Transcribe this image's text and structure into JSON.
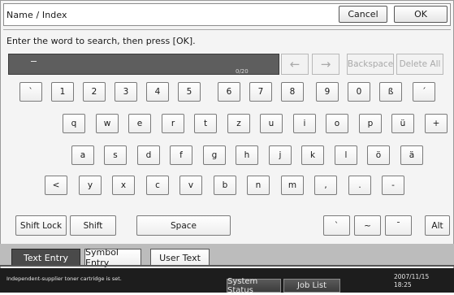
{
  "header": {
    "title": "Name / Index",
    "cancel_label": "Cancel",
    "ok_label": "OK"
  },
  "prompt": "Enter the word to search, then press [OK].",
  "input": {
    "cursor": "-",
    "counter": "0/20"
  },
  "controls": {
    "left_arrow": "←",
    "right_arrow": "→",
    "backspace": "Backspace",
    "delete_all": "Delete All"
  },
  "keyboard": {
    "row1": [
      "`",
      "1",
      "2",
      "3",
      "4",
      "5",
      "6",
      "7",
      "8",
      "9",
      "0",
      "ß",
      "´"
    ],
    "row2": [
      "q",
      "w",
      "e",
      "r",
      "t",
      "z",
      "u",
      "i",
      "o",
      "p",
      "ü",
      "+"
    ],
    "row3": [
      "a",
      "s",
      "d",
      "f",
      "g",
      "h",
      "j",
      "k",
      "l",
      "ö",
      "ä"
    ],
    "row4": [
      "<",
      "y",
      "x",
      "c",
      "v",
      "b",
      "n",
      "m",
      ",",
      ".",
      "-"
    ],
    "shift_lock": "Shift Lock",
    "shift": "Shift",
    "space": "Space",
    "accent_keys": [
      "`",
      "~",
      "¯"
    ],
    "alt": "Alt"
  },
  "tabs": [
    "Text Entry",
    "Symbol Entry",
    "User Text"
  ],
  "status": {
    "message": "Independent-supplier toner cartridge is set.",
    "system_status": "System Status",
    "job_list": "Job List",
    "date": "2007/11/15",
    "time": "18:25"
  }
}
